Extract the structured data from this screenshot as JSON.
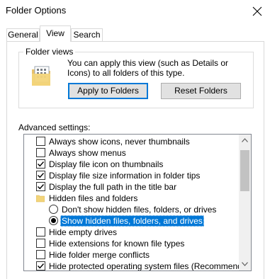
{
  "window": {
    "title": "Folder Options"
  },
  "tabs": [
    {
      "label": "General",
      "active": false
    },
    {
      "label": "View",
      "active": true
    },
    {
      "label": "Search",
      "active": false
    }
  ],
  "folder_views": {
    "label": "Folder views",
    "description": "You can apply this view (such as Details or Icons) to all folders of this type.",
    "apply_button": "Apply to Folders",
    "reset_button": "Reset Folders"
  },
  "advanced": {
    "label": "Advanced settings:",
    "items": [
      {
        "kind": "checkbox",
        "label": "Always show icons, never thumbnails",
        "checked": false
      },
      {
        "kind": "checkbox",
        "label": "Always show menus",
        "checked": false
      },
      {
        "kind": "checkbox",
        "label": "Display file icon on thumbnails",
        "checked": true
      },
      {
        "kind": "checkbox",
        "label": "Display file size information in folder tips",
        "checked": true
      },
      {
        "kind": "checkbox",
        "label": "Display the full path in the title bar",
        "checked": true
      },
      {
        "kind": "folder",
        "label": "Hidden files and folders"
      },
      {
        "kind": "radio",
        "label": "Don't show hidden files, folders, or drives",
        "checked": false
      },
      {
        "kind": "radio",
        "label": "Show hidden files, folders, and drives",
        "checked": true,
        "selected": true
      },
      {
        "kind": "checkbox",
        "label": "Hide empty drives",
        "checked": false
      },
      {
        "kind": "checkbox",
        "label": "Hide extensions for known file types",
        "checked": false
      },
      {
        "kind": "checkbox",
        "label": "Hide folder merge conflicts",
        "checked": false
      },
      {
        "kind": "checkbox",
        "label": "Hide protected operating system files (Recommended)",
        "checked": true
      }
    ]
  },
  "colors": {
    "accent": "#0078d7",
    "folder": "#f3d57a"
  },
  "icons": {
    "close": "close-icon",
    "folder": "folder-icon",
    "scroll_up": "chevron-up-icon",
    "scroll_down": "chevron-down-icon"
  }
}
